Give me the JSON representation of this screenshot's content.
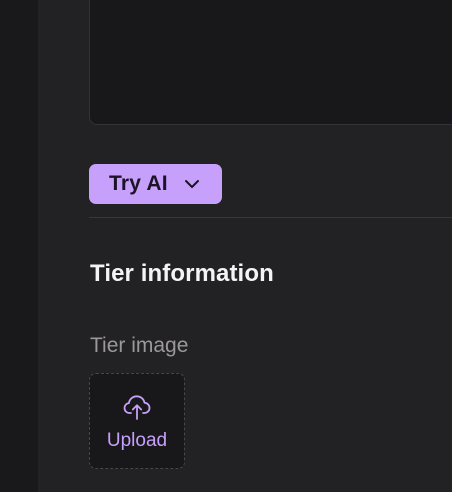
{
  "try_ai": {
    "label": "Try AI",
    "accent_color": "#c7a0fb"
  },
  "section": {
    "heading": "Tier information"
  },
  "tier_image": {
    "label": "Tier image",
    "upload_label": "Upload",
    "icon": "cloud-upload-icon"
  }
}
